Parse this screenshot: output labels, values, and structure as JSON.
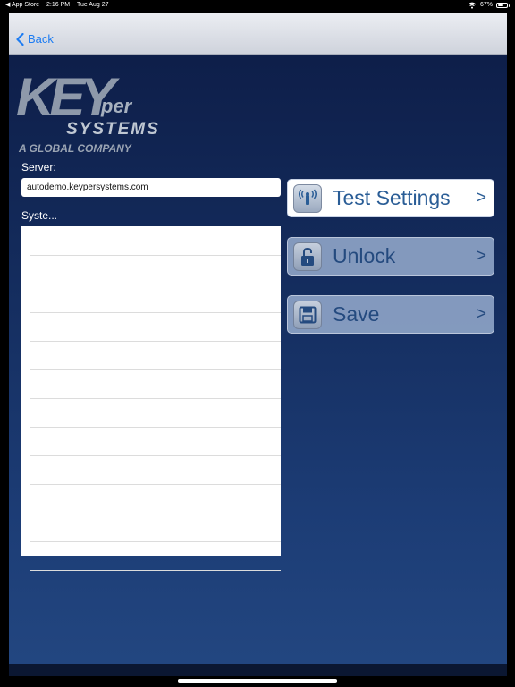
{
  "status_bar": {
    "back_app": "◀ App Store",
    "time": "2:16 PM",
    "date": "Tue Aug 27",
    "battery_percent": "67%",
    "battery_level": 0.67,
    "icons": [
      "wifi-icon",
      "battery-icon"
    ]
  },
  "navbar": {
    "back_label": "Back"
  },
  "logo": {
    "key": "KEY",
    "per": "per",
    "systems": "SYSTEMS",
    "tagline": "A GLOBAL COMPANY"
  },
  "form": {
    "server_label": "Server:",
    "server_value": "autodemo.keypersystems.com",
    "system_label": "Syste...",
    "system_rows": [
      "",
      "",
      "",
      "",
      "",
      "",
      "",
      "",
      "",
      "",
      "",
      ""
    ]
  },
  "actions": {
    "test_settings": "Test Settings",
    "unlock": "Unlock",
    "save": "Save",
    "chevron": ">"
  },
  "colors": {
    "accent": "#2a5d96",
    "nav_tint": "#1d7cf2",
    "panel_top": "#0d1c46",
    "panel_bottom": "#234781"
  }
}
